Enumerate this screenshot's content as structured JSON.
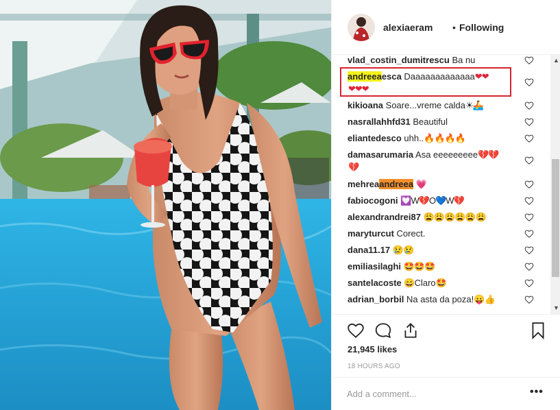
{
  "post": {
    "username": "alexiaeram",
    "separator": "•",
    "follow_status": "Following",
    "likes": "21,945 likes",
    "timestamp": "18 HOURS AGO",
    "add_comment_placeholder": "Add a comment...",
    "more_label": "•••"
  },
  "comments": [
    {
      "user": "vlad_costin_dumitrescu",
      "text": " Ba nu"
    },
    {
      "user_highlight": "andreea",
      "user_rest": "esca",
      "text": " Daaaaaaaaaaaaa",
      "emoji": "❤❤",
      "emoji2": "❤❤❤"
    },
    {
      "user": "kikioana",
      "text": " Soare...vreme calda",
      "emoji": "☀🚣"
    },
    {
      "user": "nasrallahhfd31",
      "text": " Beautiful"
    },
    {
      "user": "eliantedesco",
      "text": " uhh..",
      "emoji": "🔥🔥🔥🔥"
    },
    {
      "user": "damasarumaria",
      "text": " Asa eeeeeeeee",
      "emoji": "💔💔",
      "emoji2": "💔"
    },
    {
      "user_rest": "mehrea",
      "user_highlight": "andreea",
      "text": " ",
      "emoji": "💗"
    },
    {
      "user": "fabiocogoni",
      "text": " ",
      "emoji": "💟W💔O💙W💔"
    },
    {
      "user": "alexandrandrei87",
      "text": " ",
      "emoji": "😩😩😩😩😩😩"
    },
    {
      "user": "maryturcut",
      "text": " Corect."
    },
    {
      "user": "dana11.17",
      "text": " ",
      "emoji": "😢😢"
    },
    {
      "user": "emiliasilaghi",
      "text": " ",
      "emoji": "🤩🤩🤩"
    },
    {
      "user": "santelacoste",
      "text": " ",
      "emoji": "😄",
      "text2": "Claro",
      "emoji2": "🤩"
    },
    {
      "user": "adrian_borbil",
      "text": " Na asta da poza!",
      "emoji": "😛👍"
    },
    {
      "user": "...",
      "text": " ..."
    }
  ],
  "colors": {
    "highlight_yellow": "#f4f11a",
    "highlight_orange": "#f28f2b",
    "box_red": "#d5232e"
  },
  "icons": [
    "heart-icon",
    "comment-icon",
    "share-icon",
    "bookmark-icon",
    "like-heart-icon"
  ]
}
